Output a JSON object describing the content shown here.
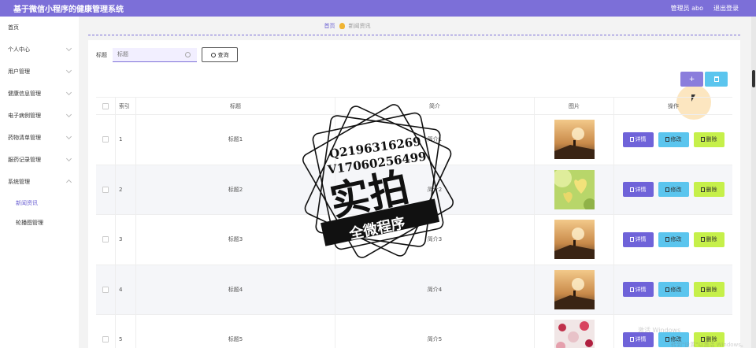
{
  "header": {
    "title": "基于微信小程序的健康管理系统",
    "admin": "管理员 abo",
    "logout": "退出登录"
  },
  "sidebar": {
    "items": [
      {
        "label": "首页"
      },
      {
        "label": "个人中心"
      },
      {
        "label": "用户管理"
      },
      {
        "label": "健康信息管理"
      },
      {
        "label": "电子病例管理"
      },
      {
        "label": "药物清单管理"
      },
      {
        "label": "服药记录管理"
      },
      {
        "label": "系统管理"
      }
    ],
    "subitems": [
      {
        "label": "新闻资讯",
        "active": true
      },
      {
        "label": "轮播图管理"
      }
    ]
  },
  "breadcrumb": {
    "home": "首页",
    "current": "新闻资讯"
  },
  "search": {
    "label": "标题",
    "placeholder": "标题",
    "button": "查询"
  },
  "toolbar": {
    "add": "+"
  },
  "table": {
    "headers": {
      "index": "索引",
      "title": "标题",
      "intro": "简介",
      "image": "图片",
      "ops": "操作"
    },
    "rows": [
      {
        "index": "1",
        "title": "标题1",
        "intro": "简介1"
      },
      {
        "index": "2",
        "title": "标题2",
        "intro": "简介2"
      },
      {
        "index": "3",
        "title": "标题3",
        "intro": "简介3"
      },
      {
        "index": "4",
        "title": "标题4",
        "intro": "简介4"
      },
      {
        "index": "5",
        "title": "标题5",
        "intro": "简介5"
      }
    ],
    "ops": {
      "detail": "详情",
      "edit": "修改",
      "delete": "删除"
    }
  },
  "watermark": {
    "qq": "Q2196316269",
    "vx": "V17060256499",
    "main": "实拍",
    "ribbon": "全微程序"
  },
  "windows_mark": {
    "line1": "激活 Windows",
    "line2": "转到\"设置\"以激活 Windows。"
  },
  "colors": {
    "brand": "#7c6fd8",
    "detail": "#6f63d9",
    "edit": "#5bc5ee",
    "delete": "#c6f04a"
  }
}
